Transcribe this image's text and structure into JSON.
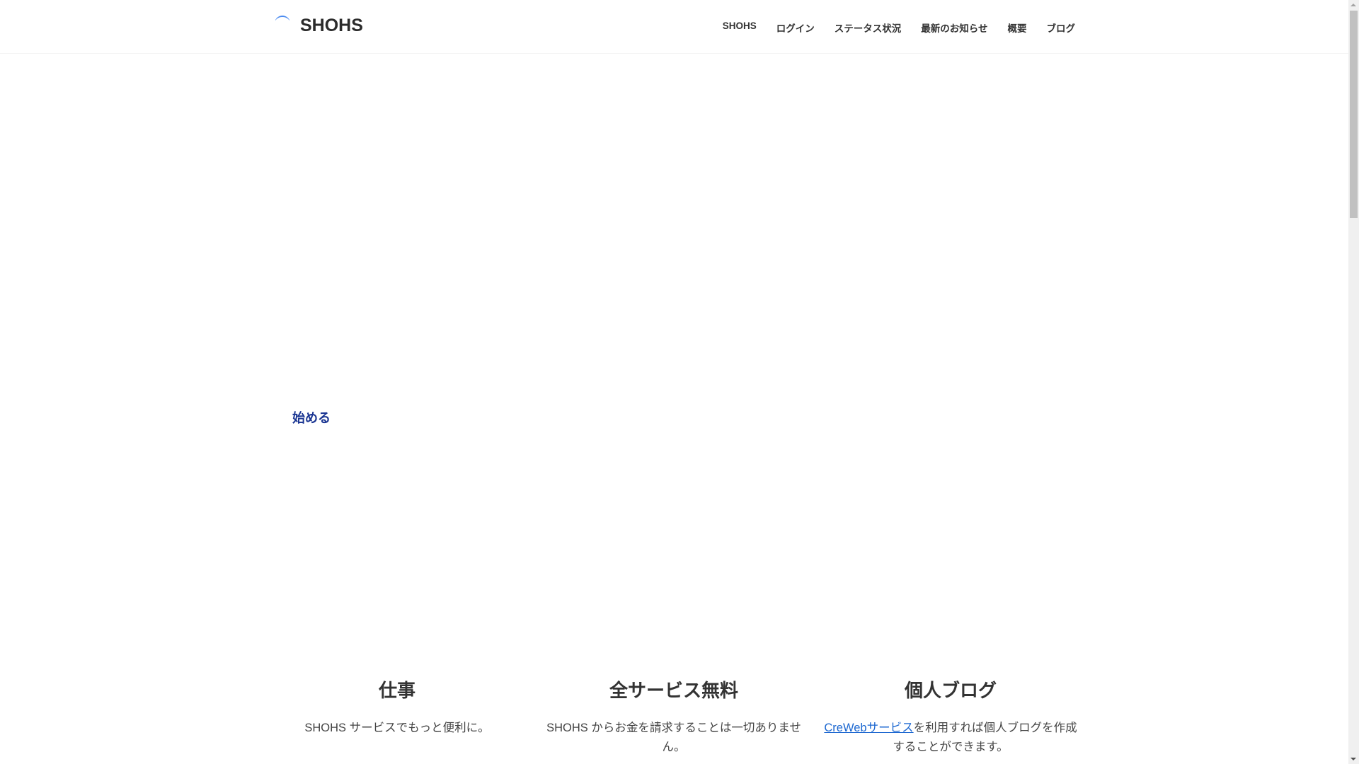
{
  "header": {
    "brand": "SHOHS",
    "nav": [
      "SHOHS",
      "ログイン",
      "ステータス状況",
      "最新のお知らせ",
      "概要",
      "ブログ"
    ]
  },
  "hero": {
    "cta": "始める"
  },
  "features": [
    {
      "title": "仕事",
      "text": "SHOHS サービスでもっと便利に。"
    },
    {
      "title": "全サービス無料",
      "text": "SHOHS からお金を請求することは一切ありません。"
    },
    {
      "title": "個人ブログ",
      "link": "CreWebサービス",
      "text": "を利用すれば個人ブログを作成することができます。"
    }
  ],
  "colors": {
    "accent": "#1a3592",
    "link": "#1a66d0"
  }
}
